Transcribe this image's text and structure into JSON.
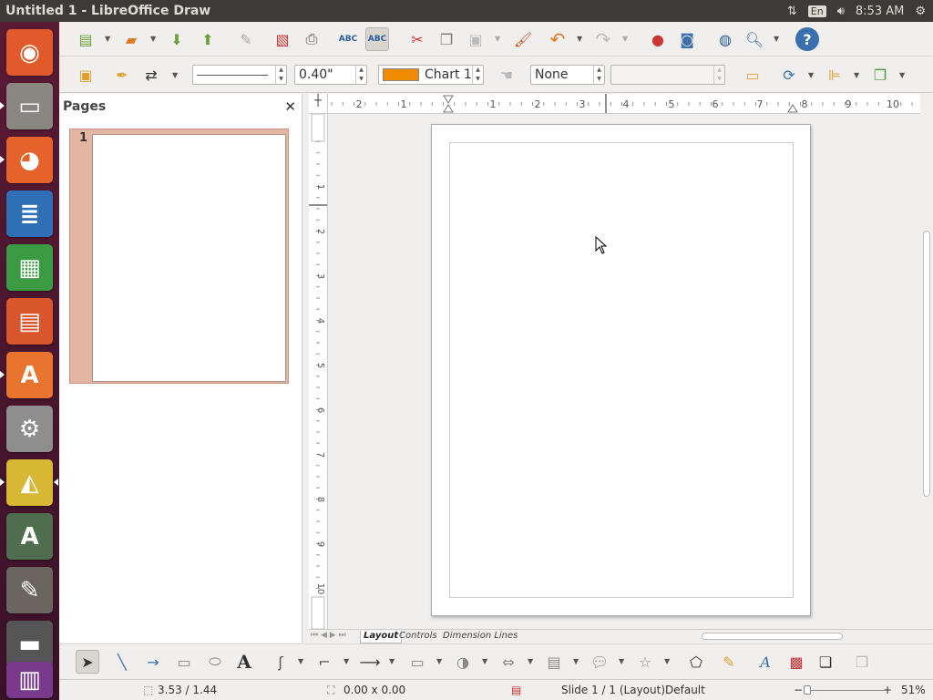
{
  "window": {
    "title": "Untitled 1 - LibreOffice Draw"
  },
  "topbar": {
    "lang": "En",
    "time": "8:53 AM"
  },
  "launcher": {
    "items": [
      {
        "name": "ubuntu-dash",
        "glyph": "◉",
        "color": "#e05a2b"
      },
      {
        "name": "files",
        "glyph": "▭",
        "color": "#8a8783"
      },
      {
        "name": "firefox",
        "glyph": "◕",
        "color": "#e5622b"
      },
      {
        "name": "writer",
        "glyph": "≣",
        "color": "#2f6fb5"
      },
      {
        "name": "calc",
        "glyph": "▦",
        "color": "#3a9b43"
      },
      {
        "name": "impress",
        "glyph": "▤",
        "color": "#d9562c"
      },
      {
        "name": "software",
        "glyph": "A",
        "color": "#e8742e"
      },
      {
        "name": "settings",
        "glyph": "⚙",
        "color": "#8e8e8e"
      },
      {
        "name": "draw",
        "glyph": "◭",
        "color": "#d7b733"
      },
      {
        "name": "updater",
        "glyph": "A",
        "color": "#4f6e4f"
      },
      {
        "name": "gimp",
        "glyph": "✎",
        "color": "#6b6560"
      },
      {
        "name": "save-disk",
        "glyph": "▬",
        "color": "#555"
      },
      {
        "name": "workspaces",
        "glyph": "▥",
        "color": "#7a3a8c"
      }
    ]
  },
  "toolbar": {
    "line_width": "0.40\"",
    "fill_color_name": "Chart 1",
    "fill_color": "#f08c00",
    "shadow_value": "None",
    "transparency_value": ""
  },
  "pages_pane": {
    "title": "Pages",
    "thumb_number": "1"
  },
  "hruler": {
    "labels": [
      "2",
      "1",
      "1",
      "2",
      "3",
      "4",
      "5",
      "6",
      "7",
      "8",
      "9",
      "10"
    ]
  },
  "vruler": {
    "labels": [
      "1",
      "2",
      "3",
      "4",
      "5",
      "6",
      "7",
      "8",
      "9",
      "10"
    ]
  },
  "tabs": {
    "layout": "Layout",
    "controls": "Controls",
    "dimension_lines": "Dimension Lines"
  },
  "status": {
    "position": "3.53 / 1.44",
    "size": "0.00 x 0.00",
    "slide": "Slide 1 / 1 (Layout)",
    "master": "Default",
    "zoom": "51%"
  }
}
